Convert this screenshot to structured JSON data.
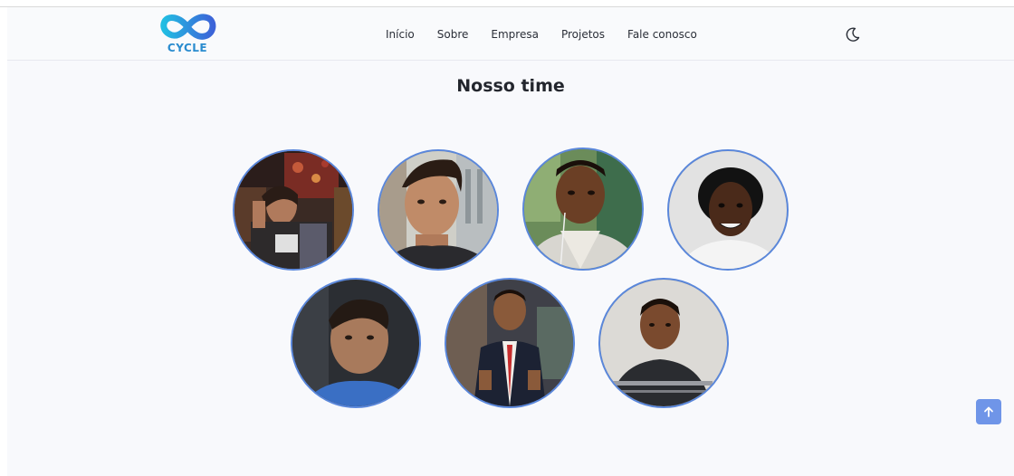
{
  "brand": {
    "logo_text": "CYCLE",
    "colors": {
      "infinity_left": "#27b3e0",
      "infinity_right": "#3b6fd9",
      "text": "#2a8ccf"
    }
  },
  "nav": {
    "items": [
      {
        "label": "Início"
      },
      {
        "label": "Sobre"
      },
      {
        "label": "Empresa"
      },
      {
        "label": "Projetos"
      },
      {
        "label": "Fale conosco"
      }
    ],
    "theme_toggle_icon": "moon-icon"
  },
  "team": {
    "title": "Nosso time",
    "members_row1": 4,
    "members_row2": 3,
    "border_color": "#5a87db"
  },
  "scroll_top_button": {
    "icon": "arrow-up-icon",
    "color": "#6f95e8"
  }
}
